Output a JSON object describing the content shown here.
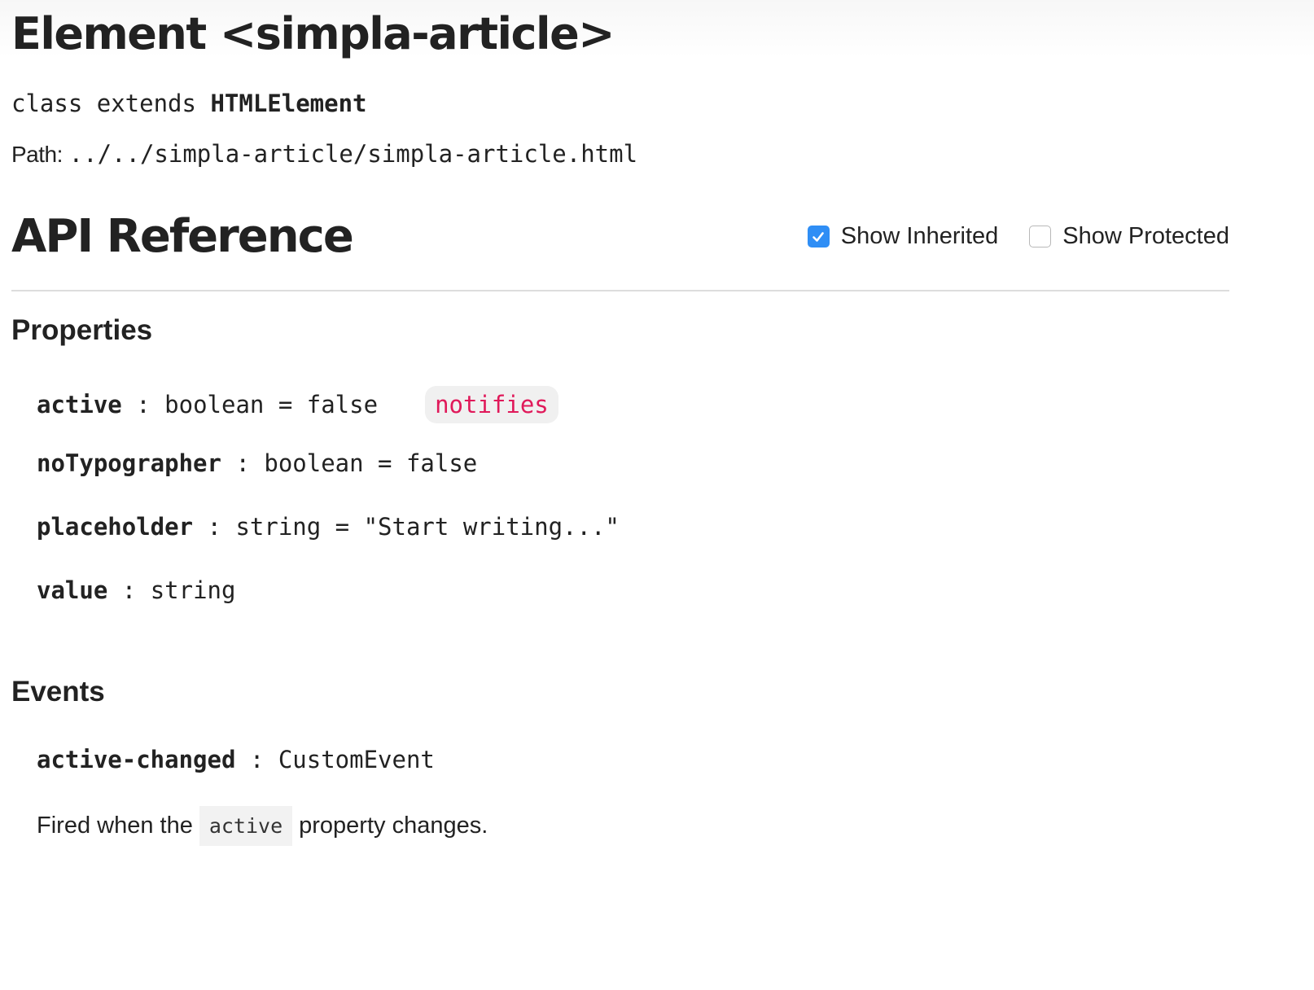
{
  "header": {
    "title": "Element <simpla-article>",
    "class_keyword": "class extends",
    "superclass": "HTMLElement",
    "path_label": "Path:",
    "path": "../../simpla-article/simpla-article.html"
  },
  "api": {
    "title": "API Reference",
    "toggles": [
      {
        "label": "Show Inherited",
        "checked": true
      },
      {
        "label": "Show Protected",
        "checked": false
      }
    ]
  },
  "properties": {
    "title": "Properties",
    "items": [
      {
        "name": "active",
        "sep": " : ",
        "type": "boolean",
        "default": " = false",
        "badge": "notifies"
      },
      {
        "name": "noTypographer",
        "sep": " : ",
        "type": "boolean",
        "default": " = false"
      },
      {
        "name": "placeholder",
        "sep": " : ",
        "type": "string",
        "default": " = \"Start writing...\""
      },
      {
        "name": "value",
        "sep": " : ",
        "type": "string",
        "default": ""
      }
    ]
  },
  "events": {
    "title": "Events",
    "items": [
      {
        "name": "active-changed",
        "sep": " : ",
        "type": "CustomEvent",
        "desc_before": "Fired when the",
        "desc_code": "active",
        "desc_after": "property changes."
      }
    ]
  },
  "colors": {
    "badge_text": "#e0195a",
    "checkbox_checked": "#2f8ef5"
  }
}
